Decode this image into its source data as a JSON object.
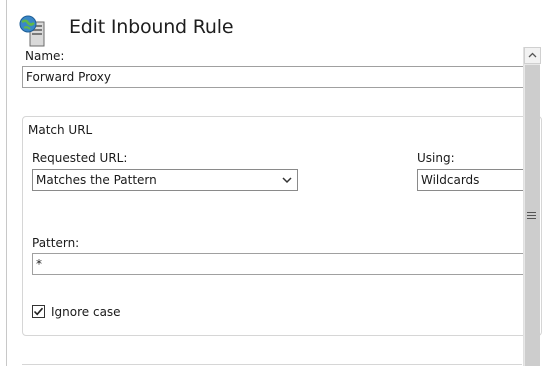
{
  "page": {
    "title": "Edit Inbound Rule",
    "icon": "web-server-icon"
  },
  "name_field": {
    "label": "Name:",
    "value": "Forward Proxy"
  },
  "match_url": {
    "group_title": "Match URL",
    "requested_url": {
      "label": "Requested URL:",
      "selected": "Matches the Pattern"
    },
    "using": {
      "label": "Using:",
      "selected": "Wildcards"
    },
    "pattern": {
      "label": "Pattern:",
      "value": "*"
    },
    "ignore_case": {
      "label": "Ignore case",
      "checked": true
    }
  },
  "scrollbar": {
    "up_icon": "chevron-up-icon",
    "grip_icon": "grip-lines-icon"
  }
}
